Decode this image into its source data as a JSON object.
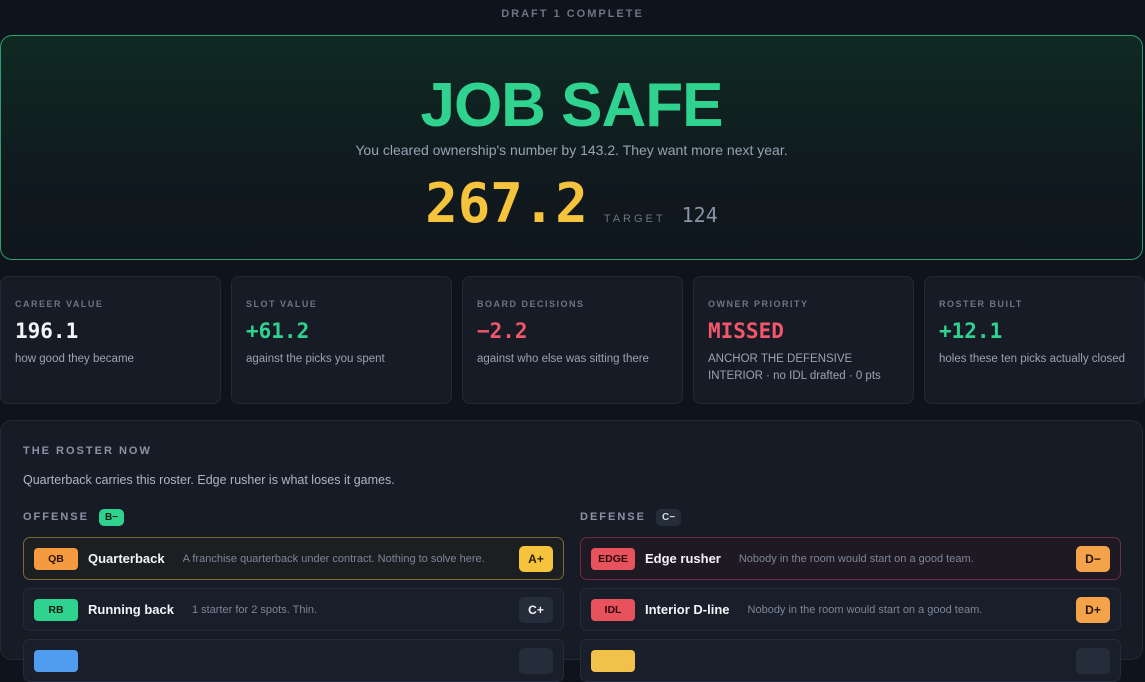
{
  "header": {
    "label": "DRAFT 1 COMPLETE"
  },
  "hero": {
    "title": "JOB SAFE",
    "subtitle": "You cleared ownership's number by 143.2. They want more next year.",
    "score": "267.2",
    "target_label": "TARGET",
    "target_value": "124"
  },
  "stats": [
    {
      "label": "CAREER VALUE",
      "value": "196.1",
      "desc": "how good they became",
      "color": "#f2f4f8"
    },
    {
      "label": "SLOT VALUE",
      "value": "+61.2",
      "desc": "against the picks you spent",
      "color": "#2fd38f"
    },
    {
      "label": "BOARD DECISIONS",
      "value": "−2.2",
      "desc": "against who else was sitting there",
      "color": "#f2576a"
    },
    {
      "label": "OWNER PRIORITY",
      "value": "MISSED",
      "desc": "ANCHOR THE DEFENSIVE INTERIOR · no IDL drafted · 0 pts",
      "color": "#f2576a"
    },
    {
      "label": "ROSTER BUILT",
      "value": "+12.1",
      "desc": "holes these ten picks actually closed",
      "color": "#2fd38f"
    }
  ],
  "roster": {
    "title": "THE ROSTER NOW",
    "subtitle": "Quarterback carries this roster. Edge rusher is what loses it games.",
    "offense": {
      "label": "OFFENSE",
      "grade": "B−",
      "rows": [
        {
          "pos": "QB",
          "name": "Quarterback",
          "note": "A franchise quarterback under contract. Nothing to solve here.",
          "grade": "A+"
        },
        {
          "pos": "RB",
          "name": "Running back",
          "note": "1 starter for 2 spots. Thin.",
          "grade": "C+"
        }
      ]
    },
    "defense": {
      "label": "DEFENSE",
      "grade": "C−",
      "rows": [
        {
          "pos": "EDGE",
          "name": "Edge rusher",
          "note": "Nobody in the room would start on a good team.",
          "grade": "D−"
        },
        {
          "pos": "IDL",
          "name": "Interior D-line",
          "note": "Nobody in the room would start on a good team.",
          "grade": "D+"
        }
      ]
    }
  }
}
